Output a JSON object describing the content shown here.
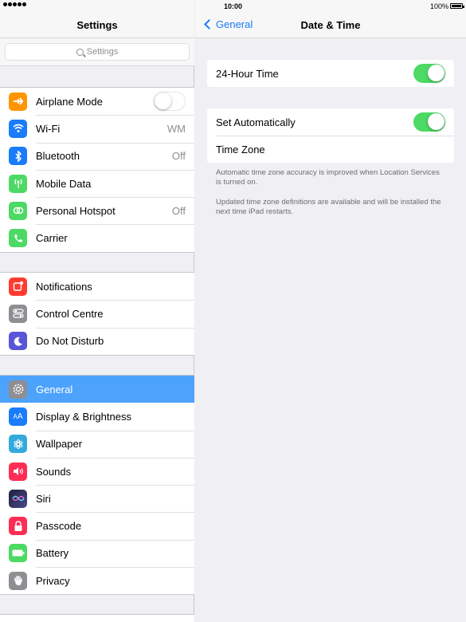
{
  "status_bar": {
    "time": "10:00",
    "battery": "100%"
  },
  "left": {
    "title": "Settings",
    "search_placeholder": "Settings",
    "groups": [
      [
        {
          "label": "Airplane Mode",
          "icon": "airplane-icon",
          "color": "#ff9500",
          "toggle": "off"
        },
        {
          "label": "Wi-Fi",
          "icon": "wifi-icon",
          "color": "#1a7cfa",
          "value": "WM"
        },
        {
          "label": "Bluetooth",
          "icon": "bluetooth-icon",
          "color": "#1a7cfa",
          "value": "Off"
        },
        {
          "label": "Mobile Data",
          "icon": "antenna-icon",
          "color": "#4cd964"
        },
        {
          "label": "Personal Hotspot",
          "icon": "hotspot-icon",
          "color": "#4cd964",
          "value": "Off"
        },
        {
          "label": "Carrier",
          "icon": "phone-icon",
          "color": "#4cd964"
        }
      ],
      [
        {
          "label": "Notifications",
          "icon": "notifications-icon",
          "color": "#ff3b30"
        },
        {
          "label": "Control Centre",
          "icon": "control-centre-icon",
          "color": "#8e8e93"
        },
        {
          "label": "Do Not Disturb",
          "icon": "moon-icon",
          "color": "#5856d6"
        }
      ],
      [
        {
          "label": "General",
          "icon": "gear-icon",
          "color": "#8e8e93",
          "selected": true
        },
        {
          "label": "Display & Brightness",
          "icon": "display-icon",
          "color": "#1a7cfa"
        },
        {
          "label": "Wallpaper",
          "icon": "wallpaper-icon",
          "color": "#34aadc"
        },
        {
          "label": "Sounds",
          "icon": "speaker-icon",
          "color": "#ff2d55"
        },
        {
          "label": "Siri",
          "icon": "siri-icon",
          "color": "#1f1f3a"
        },
        {
          "label": "Passcode",
          "icon": "lock-icon",
          "color": "#ff2d55"
        },
        {
          "label": "Battery",
          "icon": "battery-icon",
          "color": "#4cd964"
        },
        {
          "label": "Privacy",
          "icon": "hand-icon",
          "color": "#8e8e93"
        }
      ]
    ]
  },
  "right": {
    "back_label": "General",
    "title": "Date & Time",
    "time_format": {
      "label": "24-Hour Time",
      "toggle": "on"
    },
    "automatic": {
      "label": "Set Automatically",
      "toggle": "on"
    },
    "time_zone": {
      "label": "Time Zone"
    },
    "note1": "Automatic time zone accuracy is improved when Location Services is turned on.",
    "note2": "Updated time zone definitions are available and will be installed the next time iPad restarts."
  }
}
